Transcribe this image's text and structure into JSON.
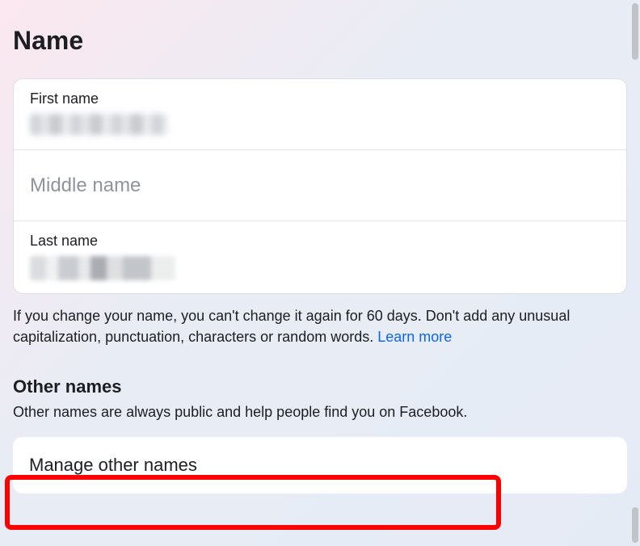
{
  "header": {
    "title": "Name"
  },
  "name_form": {
    "first": {
      "label": "First name",
      "value": ""
    },
    "middle": {
      "placeholder": "Middle name"
    },
    "last": {
      "label": "Last name",
      "value": ""
    }
  },
  "notice": {
    "text": "If you change your name, you can't change it again for 60 days. Don't add any unusual capitalization, punctuation, characters or random words. ",
    "link": "Learn more"
  },
  "other_names": {
    "title": "Other names",
    "subtitle": "Other names are always public and help people find you on Facebook.",
    "manage_label": "Manage other names"
  }
}
